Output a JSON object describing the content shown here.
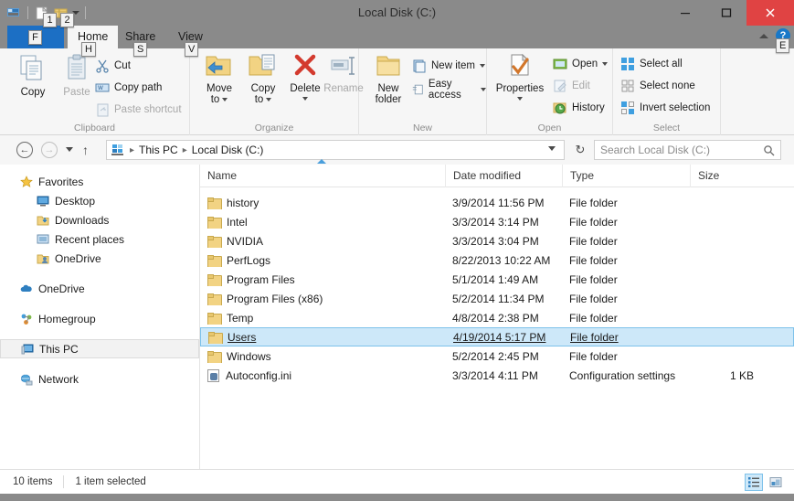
{
  "window": {
    "title": "Local Disk (C:)",
    "accent": "#1c6fc4",
    "titlebar_bg": "#8a8a8a",
    "close_bg": "#e04343",
    "controls": [
      {
        "name": "minimize",
        "glyph": "–"
      },
      {
        "name": "maximize",
        "glyph": "☐"
      },
      {
        "name": "close",
        "glyph": "✕"
      }
    ]
  },
  "quick_access": {
    "items": [
      {
        "name": "properties-qat-icon",
        "keytip": null
      },
      {
        "name": "new-folder-qat-icon",
        "keytip": "1"
      },
      {
        "name": "folder-qat-icon",
        "keytip": "2"
      }
    ],
    "customize_label": "Customize Quick Access Toolbar"
  },
  "tabs": [
    {
      "label": "File",
      "keytip": "F",
      "active": false
    },
    {
      "label": "Home",
      "keytip": "H",
      "active": true
    },
    {
      "label": "Share",
      "keytip": "S",
      "active": false
    },
    {
      "label": "View",
      "keytip": "V",
      "active": false
    }
  ],
  "ribbon_right": {
    "collapse_label": "Minimize the Ribbon",
    "help_label": "?",
    "help_keytip": "E"
  },
  "ribbon": {
    "groups": [
      {
        "name": "clipboard",
        "label": "Clipboard",
        "big": [
          {
            "label": "Copy",
            "icon": "copy-icon",
            "disabled": false
          },
          {
            "label": "Paste",
            "icon": "paste-icon",
            "disabled": true
          }
        ],
        "small": [
          {
            "label": "Cut",
            "icon": "cut-icon",
            "disabled": false
          },
          {
            "label": "Copy path",
            "icon": "copy-path-icon",
            "disabled": false
          },
          {
            "label": "Paste shortcut",
            "icon": "paste-shortcut-icon",
            "disabled": true
          }
        ]
      },
      {
        "name": "organize",
        "label": "Organize",
        "big": [
          {
            "label": "Move\nto",
            "label_l1": "Move",
            "label_l2": "to",
            "icon": "move-to-icon",
            "dropdown": true,
            "disabled": false
          },
          {
            "label": "Copy\nto",
            "label_l1": "Copy",
            "label_l2": "to",
            "icon": "copy-to-icon",
            "dropdown": true,
            "disabled": false
          },
          {
            "label": "Delete",
            "icon": "delete-icon",
            "dropdown": true,
            "disabled": false
          },
          {
            "label": "Rename",
            "icon": "rename-icon",
            "dropdown": false,
            "disabled": true
          }
        ]
      },
      {
        "name": "new",
        "label": "New",
        "big": [
          {
            "label_l1": "New",
            "label_l2": "folder",
            "icon": "new-folder-icon",
            "disabled": false
          }
        ],
        "small": [
          {
            "label": "New item",
            "icon": "new-item-icon",
            "dropdown": true,
            "disabled": false
          },
          {
            "label": "Easy access",
            "icon": "easy-access-icon",
            "dropdown": true,
            "disabled": false
          }
        ]
      },
      {
        "name": "open",
        "label": "Open",
        "big": [
          {
            "label": "Properties",
            "icon": "properties-icon",
            "dropdown": true,
            "disabled": false
          }
        ],
        "small": [
          {
            "label": "Open",
            "icon": "open-icon",
            "dropdown": true,
            "disabled": false
          },
          {
            "label": "Edit",
            "icon": "edit-icon",
            "dropdown": false,
            "disabled": true
          },
          {
            "label": "History",
            "icon": "history-icon",
            "dropdown": false,
            "disabled": false
          }
        ]
      },
      {
        "name": "select",
        "label": "Select",
        "small": [
          {
            "label": "Select all",
            "icon": "select-all-icon",
            "disabled": false
          },
          {
            "label": "Select none",
            "icon": "select-none-icon",
            "disabled": false
          },
          {
            "label": "Invert selection",
            "icon": "invert-selection-icon",
            "disabled": false
          }
        ]
      }
    ]
  },
  "address": {
    "back_label": "Back",
    "forward_label": "Forward",
    "recent_label": "Recent locations",
    "up_label": "Up one level",
    "up_glyph": "↑",
    "breadcrumbs": [
      "This PC",
      "Local Disk (C:)"
    ],
    "separator": "▸",
    "refresh_glyph": "↻",
    "refresh_label": "Refresh"
  },
  "search": {
    "placeholder": "Search Local Disk (C:)",
    "icon": "search-icon"
  },
  "sidebar": {
    "groups": [
      {
        "name": "favorites",
        "label": "Favorites",
        "icon": "star-icon",
        "children": [
          {
            "label": "Desktop",
            "icon": "desktop-icon"
          },
          {
            "label": "Downloads",
            "icon": "downloads-icon"
          },
          {
            "label": "Recent places",
            "icon": "recent-places-icon"
          },
          {
            "label": "OneDrive",
            "icon": "onedrive-folder-icon"
          }
        ]
      },
      {
        "name": "onedrive",
        "label": "OneDrive",
        "icon": "cloud-icon",
        "children": []
      },
      {
        "name": "homegroup",
        "label": "Homegroup",
        "icon": "homegroup-icon",
        "children": []
      },
      {
        "name": "this-pc",
        "label": "This PC",
        "icon": "computer-icon",
        "children": [],
        "selected": true
      },
      {
        "name": "network",
        "label": "Network",
        "icon": "network-icon",
        "children": []
      }
    ]
  },
  "filelist": {
    "columns": [
      {
        "key": "name",
        "label": "Name",
        "sorted": "asc"
      },
      {
        "key": "date",
        "label": "Date modified"
      },
      {
        "key": "type",
        "label": "Type"
      },
      {
        "key": "size",
        "label": "Size"
      }
    ],
    "rows": [
      {
        "name": "history",
        "date": "3/9/2014 11:56 PM",
        "type": "File folder",
        "size": "",
        "icon": "folder-icon",
        "selected": false
      },
      {
        "name": "Intel",
        "date": "3/3/2014 3:14 PM",
        "type": "File folder",
        "size": "",
        "icon": "folder-icon",
        "selected": false
      },
      {
        "name": "NVIDIA",
        "date": "3/3/2014 3:04 PM",
        "type": "File folder",
        "size": "",
        "icon": "folder-icon",
        "selected": false
      },
      {
        "name": "PerfLogs",
        "date": "8/22/2013 10:22 AM",
        "type": "File folder",
        "size": "",
        "icon": "folder-icon",
        "selected": false
      },
      {
        "name": "Program Files",
        "date": "5/1/2014 1:49 AM",
        "type": "File folder",
        "size": "",
        "icon": "folder-icon",
        "selected": false
      },
      {
        "name": "Program Files (x86)",
        "date": "5/2/2014 11:34 PM",
        "type": "File folder",
        "size": "",
        "icon": "folder-icon",
        "selected": false
      },
      {
        "name": "Temp",
        "date": "4/8/2014 2:38 PM",
        "type": "File folder",
        "size": "",
        "icon": "folder-icon",
        "selected": false
      },
      {
        "name": "Users",
        "date": "4/19/2014 5:17 PM",
        "type": "File folder",
        "size": "",
        "icon": "folder-icon",
        "selected": true
      },
      {
        "name": "Windows",
        "date": "5/2/2014 2:45 PM",
        "type": "File folder",
        "size": "",
        "icon": "folder-icon",
        "selected": false
      },
      {
        "name": "Autoconfig.ini",
        "date": "3/3/2014 4:11 PM",
        "type": "Configuration settings",
        "size": "1 KB",
        "icon": "ini-file-icon",
        "selected": false
      }
    ]
  },
  "statusbar": {
    "item_count": "10 items",
    "selection": "1 item selected",
    "views": [
      {
        "name": "details-view-button",
        "active": true
      },
      {
        "name": "large-icons-view-button",
        "active": false
      }
    ]
  }
}
